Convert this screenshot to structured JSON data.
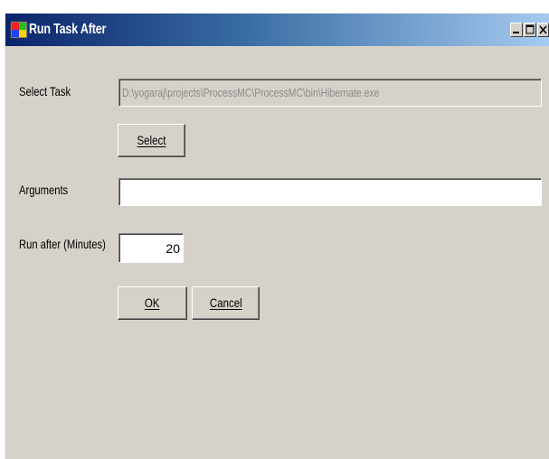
{
  "window": {
    "title": "Run Task After",
    "controls": {
      "minimize_icon": "minimize-icon",
      "maximize_icon": "maximize-icon",
      "close_icon": "close-icon"
    }
  },
  "form": {
    "select_task_label": "Select Task",
    "select_task_value": "D:\\yogaraj\\projects\\ProcessMC\\ProcessMC\\bin\\Hibernate.exe",
    "select_button_label": "Select",
    "arguments_label": "Arguments",
    "arguments_value": "",
    "run_after_label": "Run after (Minutes)",
    "run_after_value": "20",
    "ok_label": "OK",
    "cancel_label": "Cancel"
  },
  "colors": {
    "face": "#d6d2c9",
    "title_start": "#0a246a",
    "title_end": "#a6caf0",
    "disabled_text": "#8a8a8a"
  }
}
